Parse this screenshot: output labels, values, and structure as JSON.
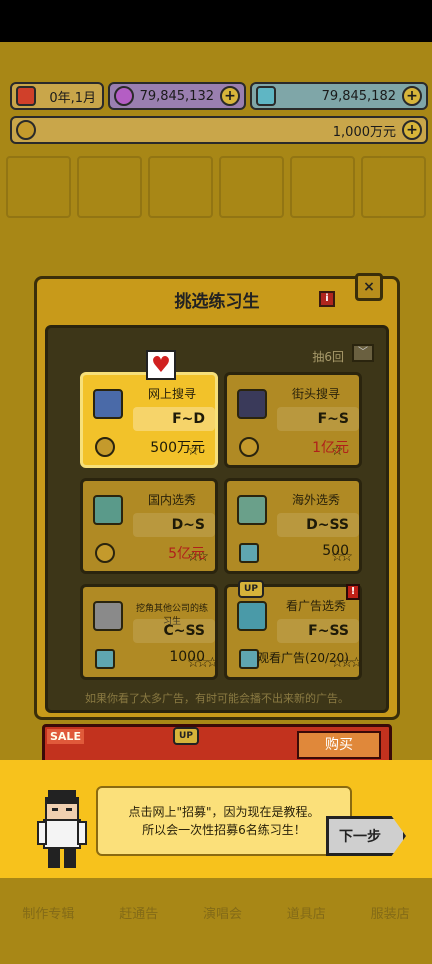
{
  "header": {
    "date": "0年,1月",
    "gems": "79,845,132",
    "tickets": "79,845,182",
    "money": "1,000万元"
  },
  "modal": {
    "title": "挑选练习生",
    "draw_label": "抽6回",
    "note": "如果你看了太多广告，有时可能会播不出来新的广告。",
    "cards": [
      {
        "title": "网上搜寻",
        "grade": "F~D",
        "cost": "500万元",
        "selected": true
      },
      {
        "title": "街头搜寻",
        "grade": "F~S",
        "cost": "1亿元"
      },
      {
        "title": "国内选秀",
        "grade": "D~S",
        "cost": "5亿元"
      },
      {
        "title": "海外选秀",
        "grade": "D~SS",
        "cost": "500"
      },
      {
        "title": "挖角其他公司的练习生",
        "grade": "C~SS",
        "cost": "1000"
      },
      {
        "title": "看广告选秀",
        "grade": "F~SS",
        "cost": "观看广告(20/20)",
        "up": "UP"
      }
    ]
  },
  "sale": {
    "tag": "SALE",
    "up": "UP",
    "buy": "购买"
  },
  "tutorial": {
    "line1": "点击网上\"招募\"，因为现在是教程。",
    "line2": "所以会一次性招募6名练习生！",
    "next_label": "下一步"
  },
  "bottom_nav": [
    "制作专辑",
    "赶通告",
    "演唱会",
    "道具店",
    "服装店"
  ]
}
